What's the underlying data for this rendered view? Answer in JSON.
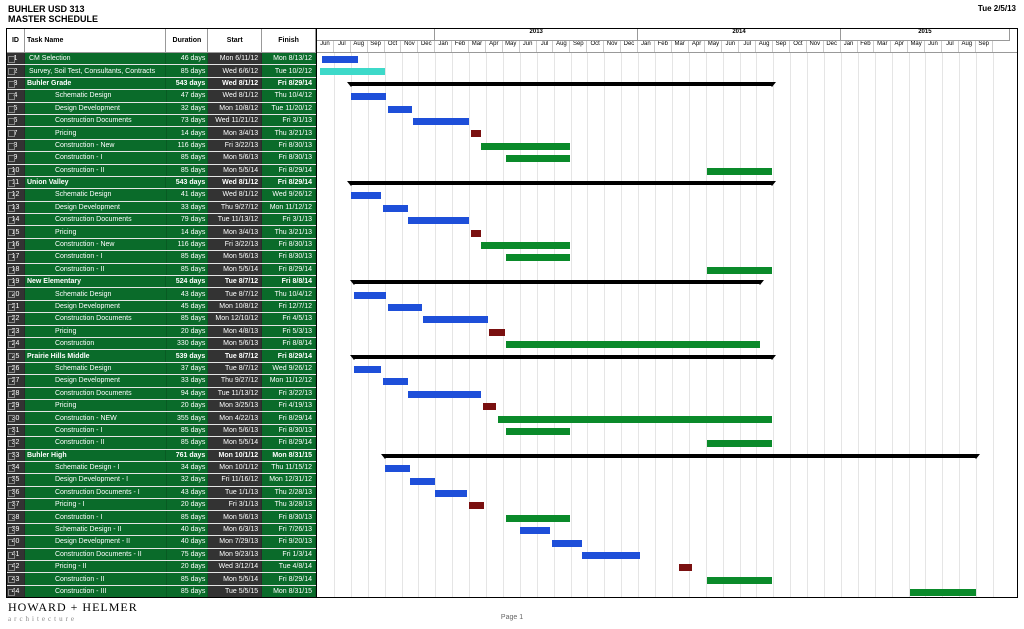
{
  "header": {
    "title1": "BUHLER USD 313",
    "title2": "MASTER SCHEDULE",
    "date": "Tue 2/5/13"
  },
  "columns": {
    "id": "ID",
    "name": "Task Name",
    "dur": "Duration",
    "start": "Start",
    "fin": "Finish"
  },
  "timeline": {
    "years": [
      {
        "y": "",
        "w": 7
      },
      {
        "y": "2013",
        "w": 12
      },
      {
        "y": "2014",
        "w": 12
      },
      {
        "y": "2015",
        "w": 10
      }
    ],
    "months": [
      "Jun",
      "Jul",
      "Aug",
      "Sep",
      "Oct",
      "Nov",
      "Dec",
      "Jan",
      "Feb",
      "Mar",
      "Apr",
      "May",
      "Jun",
      "Jul",
      "Aug",
      "Sep",
      "Oct",
      "Nov",
      "Dec",
      "Jan",
      "Feb",
      "Mar",
      "Apr",
      "May",
      "Jun",
      "Jul",
      "Aug",
      "Sep",
      "Oct",
      "Nov",
      "Dec",
      "Jan",
      "Feb",
      "Mar",
      "Apr",
      "May",
      "Jun",
      "Jul",
      "Aug",
      "Sep"
    ]
  },
  "footer": {
    "firm": "HOWARD + HELMER",
    "sub": "architecture",
    "page": "Page 1"
  },
  "colors": {
    "cyan": "#3dd9c9",
    "blue": "#1e4fd9",
    "green": "#0a8a2a",
    "dred": "#7a1010",
    "sum": "#000"
  },
  "tasks": [
    {
      "id": 1,
      "name": "CM Selection",
      "dur": "46 days",
      "start": "Mon 6/11/12",
      "fin": "Mon 8/13/12",
      "ind": 0,
      "bar": {
        "s": 0.3,
        "e": 2.4,
        "c": "blue"
      }
    },
    {
      "id": 2,
      "name": "Survey, Soil Test, Consultants, Contracts",
      "dur": "85 days",
      "start": "Wed 6/6/12",
      "fin": "Tue 10/2/12",
      "ind": 0,
      "bar": {
        "s": 0.2,
        "e": 4.0,
        "c": "cyan"
      }
    },
    {
      "id": 3,
      "name": "Buhler Grade",
      "dur": "543 days",
      "start": "Wed 8/1/12",
      "fin": "Fri 8/29/14",
      "ind": 0,
      "sum": true,
      "bar": {
        "s": 2.0,
        "e": 26.9,
        "c": "sum"
      }
    },
    {
      "id": 4,
      "name": "Schematic Design",
      "dur": "47 days",
      "start": "Wed 8/1/12",
      "fin": "Thu 10/4/12",
      "ind": 2,
      "bar": {
        "s": 2.0,
        "e": 4.1,
        "c": "blue"
      }
    },
    {
      "id": 5,
      "name": "Design Development",
      "dur": "32 days",
      "start": "Mon 10/8/12",
      "fin": "Tue 11/20/12",
      "ind": 2,
      "bar": {
        "s": 4.2,
        "e": 5.6,
        "c": "blue"
      }
    },
    {
      "id": 6,
      "name": "Construction Documents",
      "dur": "73 days",
      "start": "Wed 11/21/12",
      "fin": "Fri 3/1/13",
      "ind": 2,
      "bar": {
        "s": 5.7,
        "e": 9.0,
        "c": "blue"
      }
    },
    {
      "id": 7,
      "name": "Pricing",
      "dur": "14 days",
      "start": "Mon 3/4/13",
      "fin": "Thu 3/21/13",
      "ind": 2,
      "bar": {
        "s": 9.1,
        "e": 9.7,
        "c": "dred"
      }
    },
    {
      "id": 8,
      "name": "Construction - New",
      "dur": "116 days",
      "start": "Fri 3/22/13",
      "fin": "Fri 8/30/13",
      "ind": 2,
      "bar": {
        "s": 9.7,
        "e": 15.0,
        "c": "green"
      }
    },
    {
      "id": 9,
      "name": "Construction - I",
      "dur": "85 days",
      "start": "Mon 5/6/13",
      "fin": "Fri 8/30/13",
      "ind": 2,
      "bar": {
        "s": 11.2,
        "e": 15.0,
        "c": "green"
      }
    },
    {
      "id": 10,
      "name": "Construction - II",
      "dur": "85 days",
      "start": "Mon 5/5/14",
      "fin": "Fri 8/29/14",
      "ind": 2,
      "bar": {
        "s": 23.1,
        "e": 26.9,
        "c": "green"
      }
    },
    {
      "id": 11,
      "name": "Union Valley",
      "dur": "543 days",
      "start": "Wed 8/1/12",
      "fin": "Fri 8/29/14",
      "ind": 0,
      "sum": true,
      "bar": {
        "s": 2.0,
        "e": 26.9,
        "c": "sum"
      }
    },
    {
      "id": 12,
      "name": "Schematic Design",
      "dur": "41 days",
      "start": "Wed 8/1/12",
      "fin": "Wed 9/26/12",
      "ind": 2,
      "bar": {
        "s": 2.0,
        "e": 3.8,
        "c": "blue"
      }
    },
    {
      "id": 13,
      "name": "Design Development",
      "dur": "33 days",
      "start": "Thu 9/27/12",
      "fin": "Mon 11/12/12",
      "ind": 2,
      "bar": {
        "s": 3.9,
        "e": 5.4,
        "c": "blue"
      }
    },
    {
      "id": 14,
      "name": "Construction Documents",
      "dur": "79 days",
      "start": "Tue 11/13/12",
      "fin": "Fri 3/1/13",
      "ind": 2,
      "bar": {
        "s": 5.4,
        "e": 9.0,
        "c": "blue"
      }
    },
    {
      "id": 15,
      "name": "Pricing",
      "dur": "14 days",
      "start": "Mon 3/4/13",
      "fin": "Thu 3/21/13",
      "ind": 2,
      "bar": {
        "s": 9.1,
        "e": 9.7,
        "c": "dred"
      }
    },
    {
      "id": 16,
      "name": "Construction - New",
      "dur": "116 days",
      "start": "Fri 3/22/13",
      "fin": "Fri 8/30/13",
      "ind": 2,
      "bar": {
        "s": 9.7,
        "e": 15.0,
        "c": "green"
      }
    },
    {
      "id": 17,
      "name": "Construction - I",
      "dur": "85 days",
      "start": "Mon 5/6/13",
      "fin": "Fri 8/30/13",
      "ind": 2,
      "bar": {
        "s": 11.2,
        "e": 15.0,
        "c": "green"
      }
    },
    {
      "id": 18,
      "name": "Construction - II",
      "dur": "85 days",
      "start": "Mon 5/5/14",
      "fin": "Fri 8/29/14",
      "ind": 2,
      "bar": {
        "s": 23.1,
        "e": 26.9,
        "c": "green"
      }
    },
    {
      "id": 19,
      "name": "New Elementary",
      "dur": "524 days",
      "start": "Tue 8/7/12",
      "fin": "Fri 8/8/14",
      "ind": 0,
      "sum": true,
      "bar": {
        "s": 2.2,
        "e": 26.2,
        "c": "sum"
      }
    },
    {
      "id": 20,
      "name": "Schematic Design",
      "dur": "43 days",
      "start": "Tue 8/7/12",
      "fin": "Thu 10/4/12",
      "ind": 2,
      "bar": {
        "s": 2.2,
        "e": 4.1,
        "c": "blue"
      }
    },
    {
      "id": 21,
      "name": "Design Development",
      "dur": "45 days",
      "start": "Mon 10/8/12",
      "fin": "Fri 12/7/12",
      "ind": 2,
      "bar": {
        "s": 4.2,
        "e": 6.2,
        "c": "blue"
      }
    },
    {
      "id": 22,
      "name": "Construction Documents",
      "dur": "85 days",
      "start": "Mon 12/10/12",
      "fin": "Fri 4/5/13",
      "ind": 2,
      "bar": {
        "s": 6.3,
        "e": 10.1,
        "c": "blue"
      }
    },
    {
      "id": 23,
      "name": "Pricing",
      "dur": "20 days",
      "start": "Mon 4/8/13",
      "fin": "Fri 5/3/13",
      "ind": 2,
      "bar": {
        "s": 10.2,
        "e": 11.1,
        "c": "dred"
      }
    },
    {
      "id": 24,
      "name": "Construction",
      "dur": "330 days",
      "start": "Mon 5/6/13",
      "fin": "Fri 8/8/14",
      "ind": 2,
      "bar": {
        "s": 11.2,
        "e": 26.2,
        "c": "green"
      }
    },
    {
      "id": 25,
      "name": "Prairie Hills Middle",
      "dur": "539 days",
      "start": "Tue 8/7/12",
      "fin": "Fri 8/29/14",
      "ind": 0,
      "sum": true,
      "bar": {
        "s": 2.2,
        "e": 26.9,
        "c": "sum"
      }
    },
    {
      "id": 26,
      "name": "Schematic Design",
      "dur": "37 days",
      "start": "Tue 8/7/12",
      "fin": "Wed 9/26/12",
      "ind": 2,
      "bar": {
        "s": 2.2,
        "e": 3.8,
        "c": "blue"
      }
    },
    {
      "id": 27,
      "name": "Design Development",
      "dur": "33 days",
      "start": "Thu 9/27/12",
      "fin": "Mon 11/12/12",
      "ind": 2,
      "bar": {
        "s": 3.9,
        "e": 5.4,
        "c": "blue"
      }
    },
    {
      "id": 28,
      "name": "Construction Documents",
      "dur": "94 days",
      "start": "Tue 11/13/12",
      "fin": "Fri 3/22/13",
      "ind": 2,
      "bar": {
        "s": 5.4,
        "e": 9.7,
        "c": "blue"
      }
    },
    {
      "id": 29,
      "name": "Pricing",
      "dur": "20 days",
      "start": "Mon 3/25/13",
      "fin": "Fri 4/19/13",
      "ind": 2,
      "bar": {
        "s": 9.8,
        "e": 10.6,
        "c": "dred"
      }
    },
    {
      "id": 30,
      "name": "Construction - NEW",
      "dur": "355 days",
      "start": "Mon 4/22/13",
      "fin": "Fri 8/29/14",
      "ind": 2,
      "bar": {
        "s": 10.7,
        "e": 26.9,
        "c": "green"
      }
    },
    {
      "id": 31,
      "name": "Construction - I",
      "dur": "85 days",
      "start": "Mon 5/6/13",
      "fin": "Fri 8/30/13",
      "ind": 2,
      "bar": {
        "s": 11.2,
        "e": 15.0,
        "c": "green"
      }
    },
    {
      "id": 32,
      "name": "Construction - II",
      "dur": "85 days",
      "start": "Mon 5/5/14",
      "fin": "Fri 8/29/14",
      "ind": 2,
      "bar": {
        "s": 23.1,
        "e": 26.9,
        "c": "green"
      }
    },
    {
      "id": 33,
      "name": "Buhler High",
      "dur": "761 days",
      "start": "Mon 10/1/12",
      "fin": "Mon 8/31/15",
      "ind": 0,
      "sum": true,
      "bar": {
        "s": 4.0,
        "e": 39.0,
        "c": "sum"
      }
    },
    {
      "id": 34,
      "name": "Schematic Design - I",
      "dur": "34 days",
      "start": "Mon 10/1/12",
      "fin": "Thu 11/15/12",
      "ind": 2,
      "bar": {
        "s": 4.0,
        "e": 5.5,
        "c": "blue"
      }
    },
    {
      "id": 35,
      "name": "Design Development - I",
      "dur": "32 days",
      "start": "Fri 11/16/12",
      "fin": "Mon 12/31/12",
      "ind": 2,
      "bar": {
        "s": 5.5,
        "e": 7.0,
        "c": "blue"
      }
    },
    {
      "id": 36,
      "name": "Construction Documents - I",
      "dur": "43 days",
      "start": "Tue 1/1/13",
      "fin": "Thu 2/28/13",
      "ind": 2,
      "bar": {
        "s": 7.0,
        "e": 8.9,
        "c": "blue"
      }
    },
    {
      "id": 37,
      "name": "Pricing - I",
      "dur": "20 days",
      "start": "Fri 3/1/13",
      "fin": "Thu 3/28/13",
      "ind": 2,
      "bar": {
        "s": 9.0,
        "e": 9.9,
        "c": "dred"
      }
    },
    {
      "id": 38,
      "name": "Construction - I",
      "dur": "85 days",
      "start": "Mon 5/6/13",
      "fin": "Fri 8/30/13",
      "ind": 2,
      "bar": {
        "s": 11.2,
        "e": 15.0,
        "c": "green"
      }
    },
    {
      "id": 39,
      "name": "Schematic Design - II",
      "dur": "40 days",
      "start": "Mon 6/3/13",
      "fin": "Fri 7/26/13",
      "ind": 2,
      "bar": {
        "s": 12,
        "e": 13.8,
        "c": "blue"
      }
    },
    {
      "id": 40,
      "name": "Design Development - II",
      "dur": "40 days",
      "start": "Mon 7/29/13",
      "fin": "Fri 9/20/13",
      "ind": 2,
      "bar": {
        "s": 13.9,
        "e": 15.7,
        "c": "blue"
      }
    },
    {
      "id": 41,
      "name": "Construction Documents - II",
      "dur": "75 days",
      "start": "Mon 9/23/13",
      "fin": "Fri 1/3/14",
      "ind": 2,
      "bar": {
        "s": 15.7,
        "e": 19.1,
        "c": "blue"
      }
    },
    {
      "id": 42,
      "name": "Pricing - II",
      "dur": "20 days",
      "start": "Wed 3/12/14",
      "fin": "Tue 4/8/14",
      "ind": 2,
      "bar": {
        "s": 21.4,
        "e": 22.2,
        "c": "dred"
      }
    },
    {
      "id": 43,
      "name": "Construction - II",
      "dur": "85 days",
      "start": "Mon 5/5/14",
      "fin": "Fri 8/29/14",
      "ind": 2,
      "bar": {
        "s": 23.1,
        "e": 26.9,
        "c": "green"
      }
    },
    {
      "id": 44,
      "name": "Construction - III",
      "dur": "85 days",
      "start": "Tue 5/5/15",
      "fin": "Mon 8/31/15",
      "ind": 2,
      "bar": {
        "s": 35.1,
        "e": 39.0,
        "c": "green"
      }
    }
  ]
}
